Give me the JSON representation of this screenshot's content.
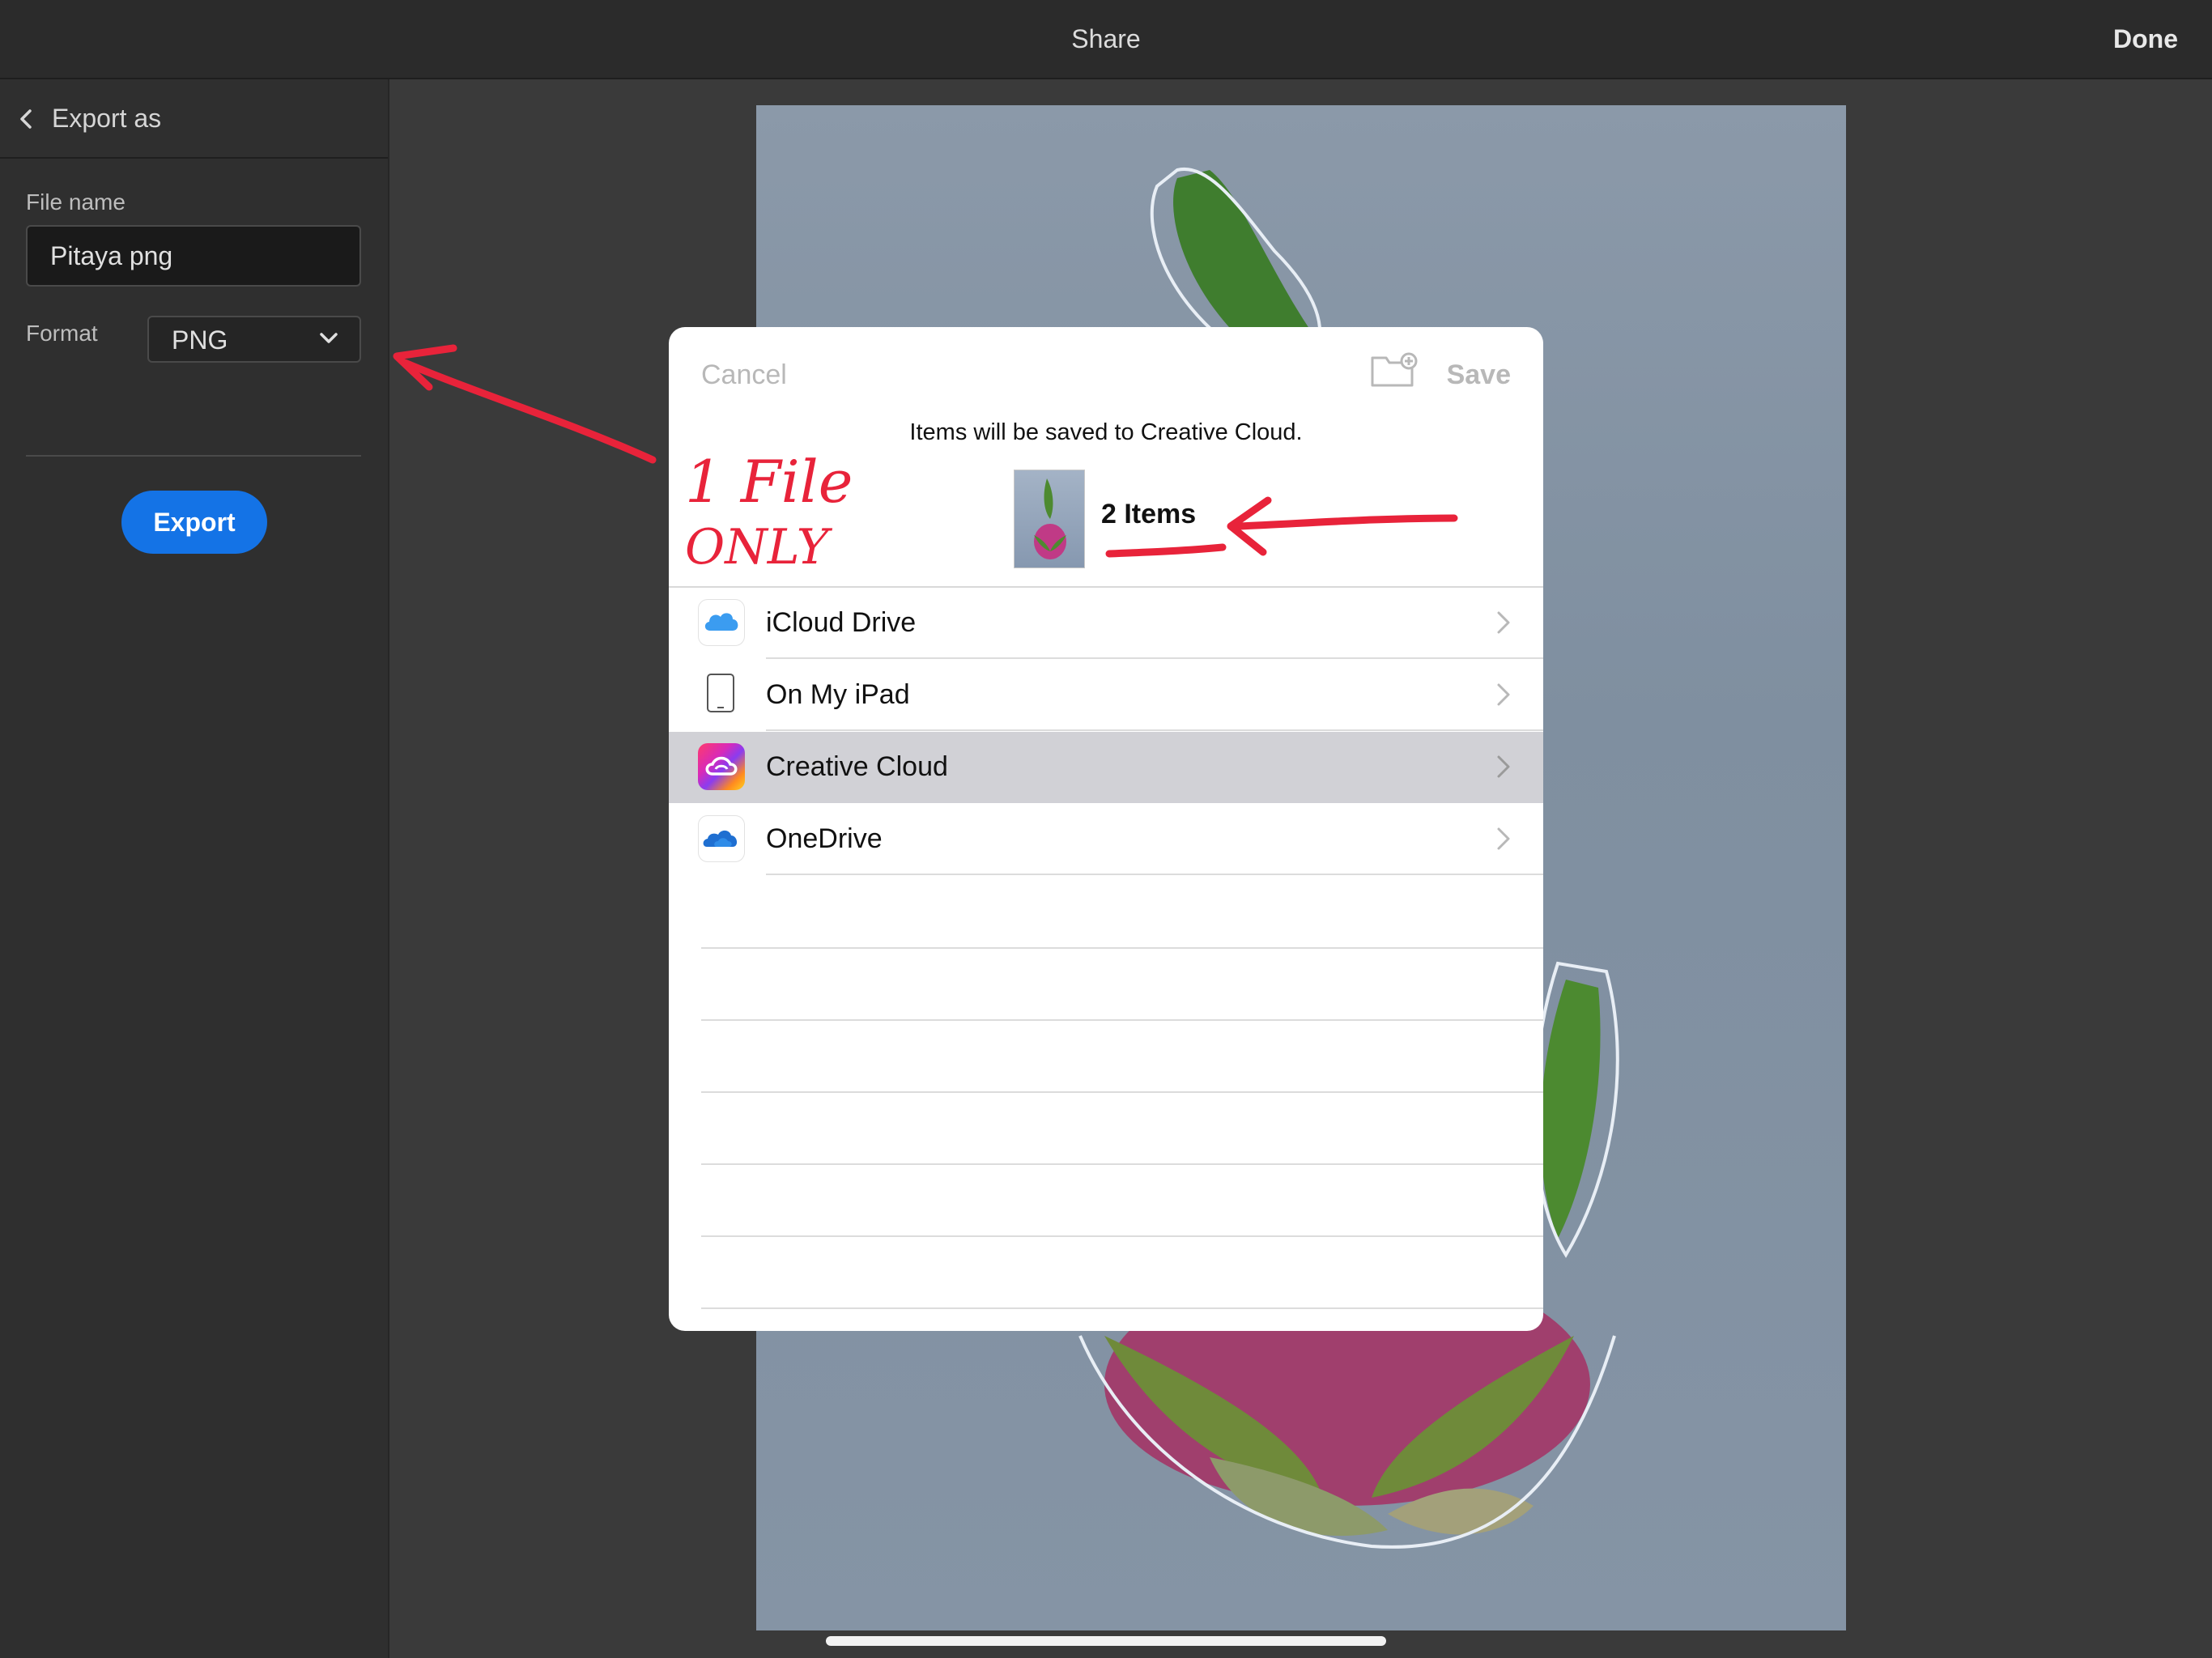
{
  "header": {
    "title": "Share",
    "done_label": "Done"
  },
  "sidebar": {
    "back_label": "Export as",
    "file_name_label": "File name",
    "file_name_value": "Pitaya png",
    "format_label": "Format",
    "format_value": "PNG",
    "export_label": "Export"
  },
  "dialog": {
    "cancel_label": "Cancel",
    "save_label": "Save",
    "info_text": "Items will be saved to Creative Cloud.",
    "items_count": "2 Items",
    "locations": [
      {
        "label": "iCloud Drive",
        "icon": "icloud-icon"
      },
      {
        "label": "On My iPad",
        "icon": "ipad-icon"
      },
      {
        "label": "Creative Cloud",
        "icon": "creative-cloud-icon",
        "selected": true
      },
      {
        "label": "OneDrive",
        "icon": "onedrive-icon"
      }
    ]
  },
  "annotation": {
    "text_line1": "1 File",
    "text_line2": "ONLY"
  },
  "colors": {
    "accent": "#1473e6",
    "annotation": "#e8233a",
    "selected_row": "#d1d1d6"
  }
}
